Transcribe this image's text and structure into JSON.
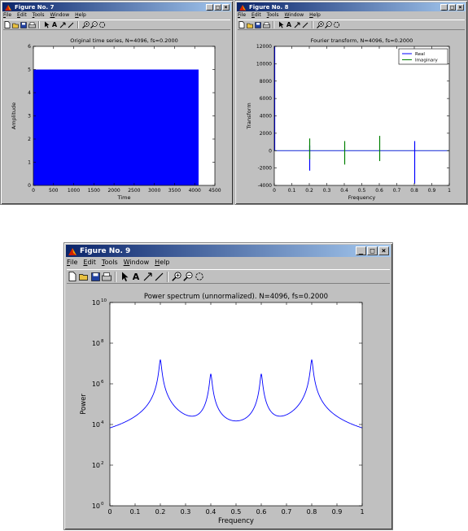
{
  "menu_labels": [
    "File",
    "Edit",
    "Tools",
    "Window",
    "Help"
  ],
  "controls": {
    "minimize": "_",
    "maximize": "□",
    "close": "×"
  },
  "windows": {
    "fig7": {
      "title": "Figure No. 7",
      "chart_data": {
        "type": "area",
        "title": "Original time series, N=4096, fs=0.2000",
        "xlabel": "Time",
        "ylabel": "Amplitude",
        "xlim": [
          0,
          4500
        ],
        "ylim": [
          0,
          6
        ],
        "xticks": [
          "0",
          "500",
          "1000",
          "1500",
          "2000",
          "2500",
          "3000",
          "3500",
          "4000",
          "4500"
        ],
        "yticks": [
          "0",
          "1",
          "2",
          "3",
          "4",
          "5",
          "6"
        ],
        "series": [
          {
            "x_start": 0,
            "x_end": 4096,
            "value": 5,
            "color": "#0000ff"
          }
        ]
      }
    },
    "fig8": {
      "title": "Figure No. 8",
      "chart_data": {
        "type": "line",
        "title": "Fourier transform, N=4096, fs=0.2000",
        "xlabel": "Frequency",
        "ylabel": "Transform",
        "xlim": [
          0,
          1
        ],
        "ylim": [
          -4000,
          12000
        ],
        "xticks": [
          "0",
          "0.1",
          "0.2",
          "0.3",
          "0.4",
          "0.5",
          "0.6",
          "0.7",
          "0.8",
          "0.9",
          "1"
        ],
        "yticks": [
          "-4000",
          "-2000",
          "0",
          "2000",
          "4000",
          "6000",
          "8000",
          "10000",
          "12000"
        ],
        "legend": [
          "Real",
          "Imaginary"
        ],
        "series": [
          {
            "name": "Real",
            "color": "#0000ff",
            "spikes": [
              {
                "x": 0.0,
                "min": 0,
                "max": 12000
              },
              {
                "x": 0.2,
                "min": -2300,
                "max": 600
              },
              {
                "x": 0.8,
                "min": -3800,
                "max": 1100
              }
            ]
          },
          {
            "name": "Imaginary",
            "color": "#008000",
            "spikes": [
              {
                "x": 0.2,
                "min": -1000,
                "max": 1400
              },
              {
                "x": 0.4,
                "min": -1600,
                "max": 1100
              },
              {
                "x": 0.6,
                "min": -1200,
                "max": 1700
              }
            ]
          }
        ]
      }
    },
    "fig9": {
      "title": "Figure No. 9",
      "chart_data": {
        "type": "line",
        "title": "Power spectrum (unnormalized). N=4096, fs=0.2000",
        "xlabel": "Frequency",
        "ylabel": "Power",
        "xlim": [
          0,
          1
        ],
        "ylim": [
          1,
          10000000000
        ],
        "yscale": "log",
        "xticks": [
          "0",
          "0.1",
          "0.2",
          "0.3",
          "0.4",
          "0.5",
          "0.6",
          "0.7",
          "0.8",
          "0.9",
          "1"
        ],
        "yticks": [
          "10^0",
          "10^2",
          "10^4",
          "10^6",
          "10^8",
          "10^10"
        ],
        "peaks": [
          0.2,
          0.4,
          0.6,
          0.8
        ],
        "peak_values": [
          15000000.0,
          3000000.0,
          3000000.0,
          15000000.0
        ],
        "floor_value": 4,
        "series": [
          {
            "color": "#0000ff"
          }
        ]
      }
    }
  }
}
